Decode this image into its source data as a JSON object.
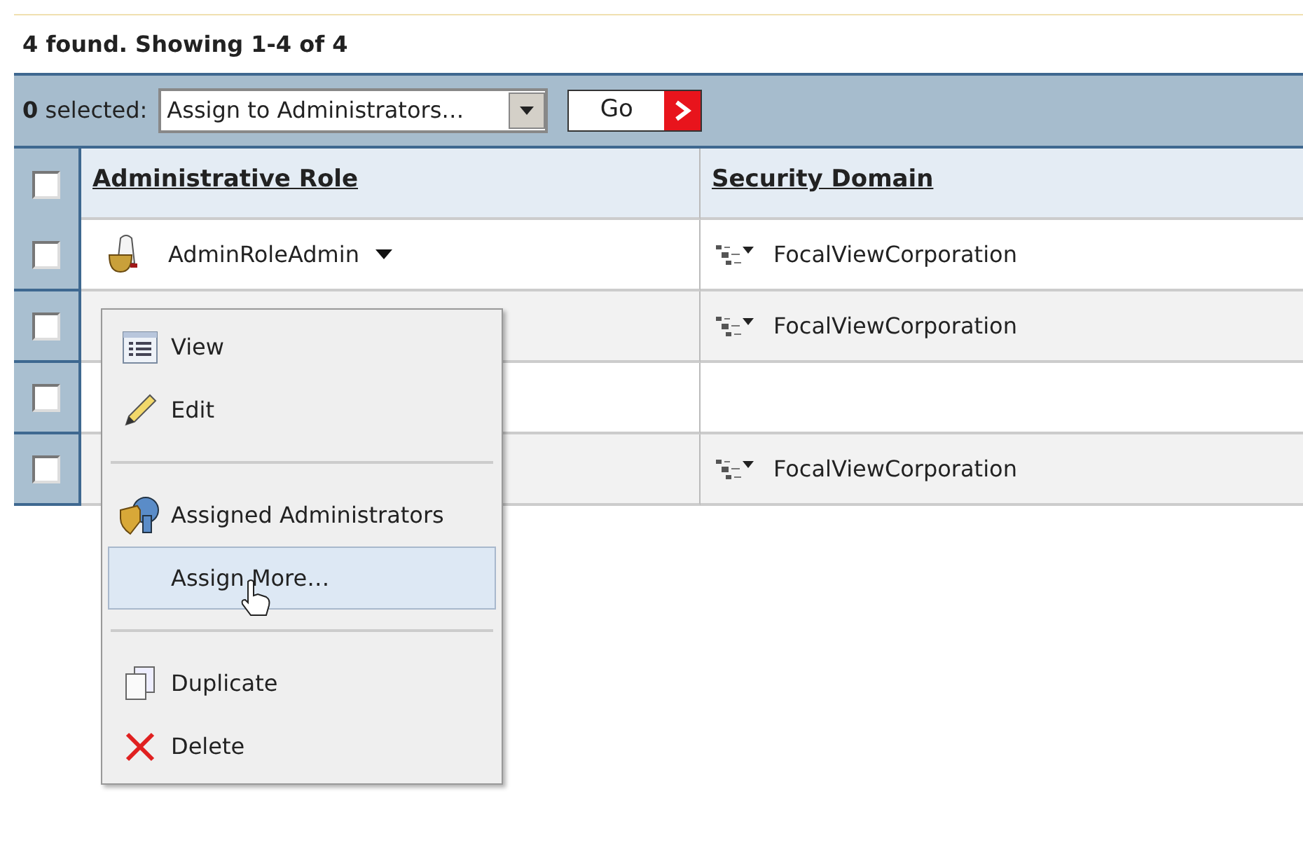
{
  "summary": "4 found. Showing 1-4 of 4",
  "toolbar": {
    "count": "0",
    "count_label": "selected:",
    "action": {
      "value": "Assign to Administrators…"
    },
    "go_button": "Go"
  },
  "table": {
    "select_all": {
      "checked": false
    },
    "columns": [
      "Administrative Role",
      "Security Domain"
    ],
    "rows": [
      {
        "checked": false,
        "role": "AdminRoleAdmin",
        "domain": "FocalViewCorporation"
      },
      {
        "checked": false,
        "domain": "FocalViewCorporation"
      },
      {
        "checked": false
      },
      {
        "checked": false,
        "domain": "FocalViewCorporation"
      }
    ]
  },
  "context_menu": {
    "items": [
      {
        "kind": "item",
        "label": "View",
        "selected": false
      },
      {
        "kind": "item",
        "label": "Edit",
        "selected": false
      },
      {
        "kind": "separator"
      },
      {
        "kind": "item",
        "label": "Assigned Administrators",
        "selected": false
      },
      {
        "kind": "item",
        "label": "Assign More…",
        "selected": true
      },
      {
        "kind": "separator"
      },
      {
        "kind": "item",
        "label": "Duplicate",
        "selected": false
      },
      {
        "kind": "item",
        "label": "Delete",
        "selected": false
      }
    ]
  }
}
